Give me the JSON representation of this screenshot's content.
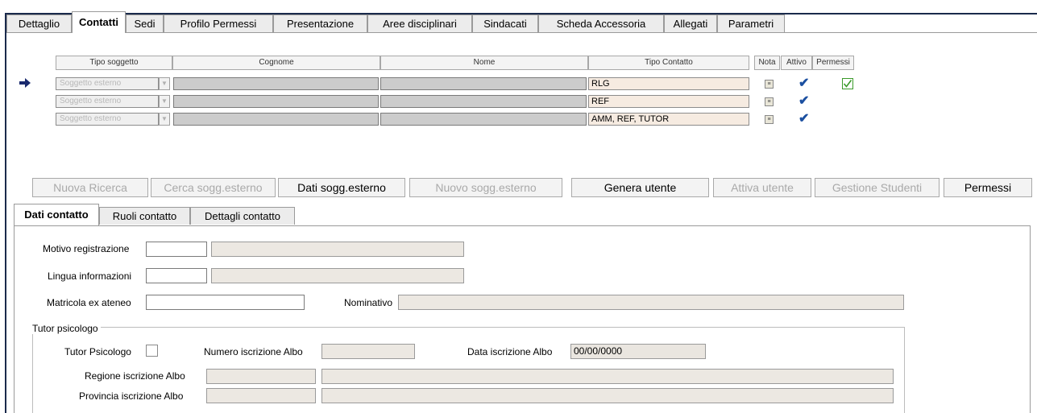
{
  "main_tabs": [
    "Dettaglio",
    "Contatti",
    "Sedi",
    "Profilo Permessi",
    "Presentazione",
    "Aree disciplinari",
    "Sindacati",
    "Scheda Accessoria",
    "Allegati",
    "Parametri"
  ],
  "grid": {
    "headers": {
      "tipo_soggetto": "Tipo soggetto",
      "cognome": "Cognome",
      "nome": "Nome",
      "tipo_contatto": "Tipo Contatto",
      "nota": "Nota",
      "attivo": "Attivo",
      "permessi": "Permessi"
    },
    "rows": [
      {
        "tipo_soggetto": "Soggetto esterno",
        "cognome": "",
        "nome": "",
        "tipo_contatto": "RLG",
        "attivo": true,
        "permessi": true
      },
      {
        "tipo_soggetto": "Soggetto esterno",
        "cognome": "",
        "nome": "",
        "tipo_contatto": "REF",
        "attivo": true,
        "permessi": false
      },
      {
        "tipo_soggetto": "Soggetto esterno",
        "cognome": "",
        "nome": "",
        "tipo_contatto": "AMM, REF, TUTOR",
        "attivo": true,
        "permessi": false
      }
    ]
  },
  "actions": {
    "nuova_ricerca": "Nuova Ricerca",
    "cerca_sogg_esterno": "Cerca sogg.esterno",
    "dati_sogg_esterno": "Dati sogg.esterno",
    "nuovo_sogg_esterno": "Nuovo sogg.esterno",
    "genera_utente": "Genera utente",
    "attiva_utente": "Attiva utente",
    "gestione_studenti": "Gestione Studenti",
    "permessi": "Permessi"
  },
  "sub_tabs": [
    "Dati contatto",
    "Ruoli contatto",
    "Dettagli contatto"
  ],
  "form": {
    "motivo_registrazione": "Motivo registrazione",
    "lingua_informazioni": "Lingua informazioni",
    "matricola_ex_ateneo": "Matricola ex ateneo",
    "nominativo": "Nominativo",
    "tutor_group_title": "Tutor psicologo",
    "tutor_psicologo": "Tutor Psicologo",
    "numero_iscrizione_albo": "Numero iscrizione Albo",
    "data_iscrizione_albo": "Data iscrizione Albo",
    "data_iscrizione_albo_value": "00/00/0000",
    "regione_iscrizione_albo": "Regione iscrizione Albo",
    "provincia_iscrizione_albo": "Provincia iscrizione Albo"
  },
  "colors": {
    "tipo_contatto_bg": "#f6ebe1",
    "arrow": "#1a2a6e",
    "check_blue": "#1b4fa0",
    "check_green": "#3a9a2a"
  }
}
